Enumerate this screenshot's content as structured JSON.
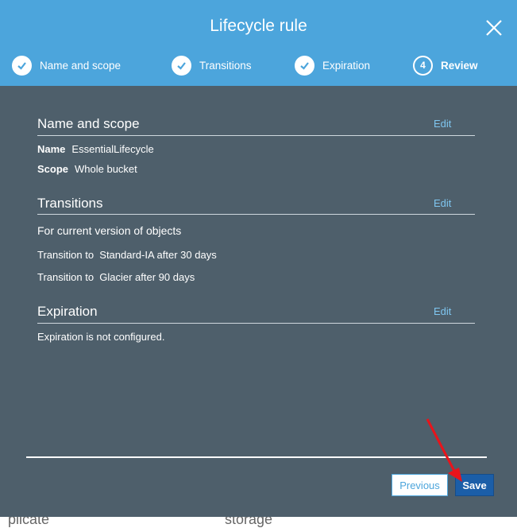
{
  "modal": {
    "title": "Lifecycle rule",
    "steps": [
      {
        "label": "Name and scope",
        "state": "complete",
        "icon": "check-icon"
      },
      {
        "label": "Transitions",
        "state": "complete",
        "icon": "check-icon"
      },
      {
        "label": "Expiration",
        "state": "complete",
        "icon": "check-icon"
      },
      {
        "number": "4",
        "label": "Review",
        "state": "current"
      }
    ],
    "close_icon": "close-icon"
  },
  "review": {
    "name_scope": {
      "title": "Name and scope",
      "edit_label": "Edit",
      "name_key": "Name",
      "name_value": "EssentialLifecycle",
      "scope_key": "Scope",
      "scope_value": "Whole bucket"
    },
    "transitions": {
      "title": "Transitions",
      "edit_label": "Edit",
      "subheading": "For current version of objects",
      "lines": [
        "Transition to  Standard-IA after 30 days",
        "Transition to  Glacier after 90 days"
      ]
    },
    "expiration": {
      "title": "Expiration",
      "edit_label": "Edit",
      "text": "Expiration is not configured."
    }
  },
  "footer": {
    "previous_label": "Previous",
    "save_label": "Save"
  },
  "background": {
    "fragment_left": "plicate",
    "fragment_right": "storage"
  },
  "colors": {
    "header": "#4ca5dc",
    "body": "#4e5f6b",
    "save_button": "#1b5ea8",
    "edit_link": "#7fc6f0",
    "annotation_arrow": "#e8141b"
  }
}
